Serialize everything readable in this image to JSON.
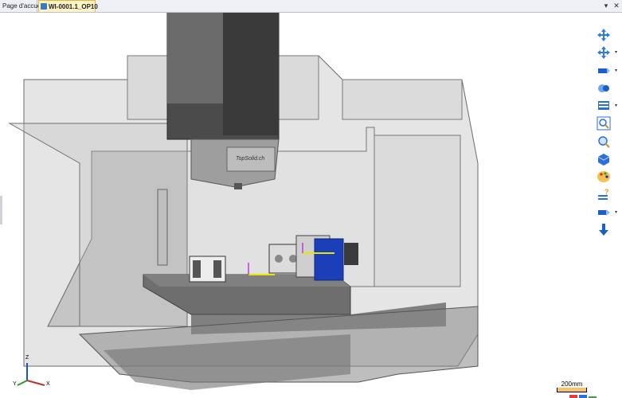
{
  "tabs": [
    {
      "label": "Page d'accueil",
      "active": false
    },
    {
      "label": "WI-0001.1_OP10",
      "active": true
    }
  ],
  "window_controls": {
    "dropdown": "▾",
    "close": "✕"
  },
  "scene": {
    "spindle_branding": "TopSolid.ch"
  },
  "toolbar_icons": [
    "pan-icon",
    "rotate-icon",
    "view-orientation-icon",
    "zoom-region-icon",
    "display-mode-icon",
    "zoom-fit-icon",
    "zoom-icon",
    "shaded-view-icon",
    "color-palette-icon",
    "help-icon",
    "section-view-icon",
    "export-icon"
  ],
  "scale": {
    "label": "200mm"
  },
  "triad": {
    "z": "Z",
    "y": "Y",
    "x": "X"
  },
  "colors": {
    "machine_grey": "#a6a6a6",
    "spindle_dark": "#3d3d3d",
    "rotary_blue": "#1a3fb8",
    "tab_active": "#fff3c4"
  }
}
